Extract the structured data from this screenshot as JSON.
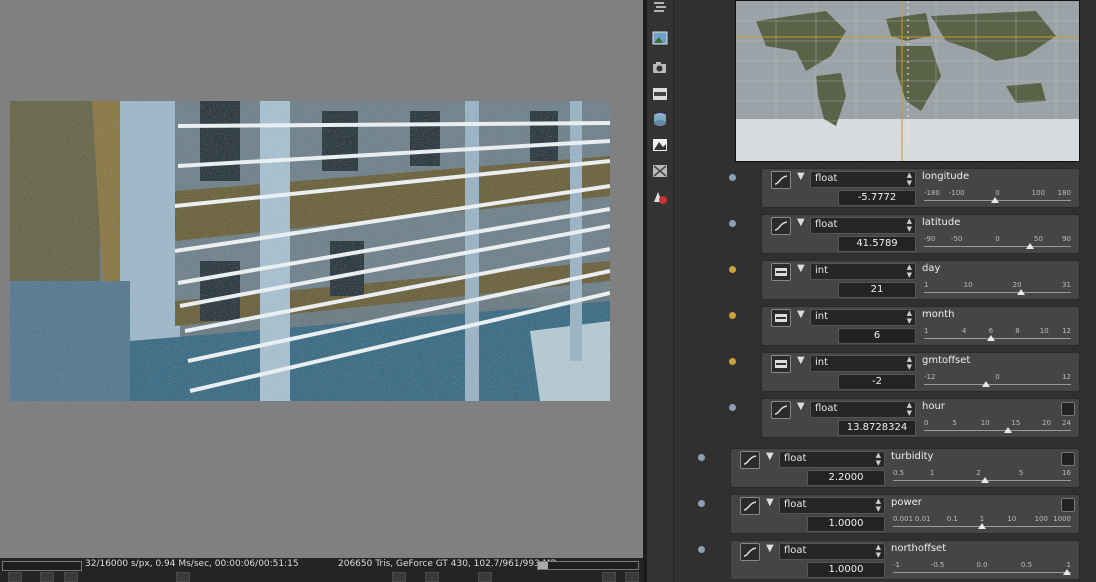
{
  "status": {
    "samples": "32/16000 s/px, 0.94 Ms/sec, 00:00:06/00:51:15",
    "gpu": "206650 Tris, GeForce GT 430, 102.7/961/993 MB"
  },
  "params": [
    {
      "id": "longitude",
      "type": "float",
      "value": "-5.7772",
      "ticks": [
        "-180",
        "-100",
        "0",
        "100",
        "180"
      ],
      "min": -180,
      "max": 180,
      "current": -5.7772,
      "kind": "float",
      "corner": false
    },
    {
      "id": "latitude",
      "type": "float",
      "value": "41.5789",
      "ticks": [
        "-90",
        "-50",
        "0",
        "50",
        "90"
      ],
      "min": -90,
      "max": 90,
      "current": 41.5789,
      "kind": "float",
      "corner": false
    },
    {
      "id": "day",
      "type": "int",
      "value": "21",
      "ticks": [
        "1",
        "10",
        "20",
        "31"
      ],
      "min": 1,
      "max": 31,
      "current": 21,
      "kind": "int",
      "corner": false
    },
    {
      "id": "month",
      "type": "int",
      "value": "6",
      "ticks": [
        "1",
        "4",
        "6",
        "8",
        "10",
        "12"
      ],
      "min": 1,
      "max": 12,
      "current": 6,
      "kind": "int",
      "corner": false
    },
    {
      "id": "gmtoffset",
      "type": "int",
      "value": "-2",
      "ticks": [
        "-12",
        "0",
        "12"
      ],
      "min": -12,
      "max": 12,
      "current": -2,
      "kind": "int",
      "corner": false
    },
    {
      "id": "hour",
      "type": "float",
      "value": "13.8728324",
      "ticks": [
        "0",
        "5",
        "10",
        "15",
        "20",
        "24"
      ],
      "min": 0,
      "max": 24,
      "current": 13.8728324,
      "kind": "float",
      "corner": true
    },
    {
      "id": "turbidity",
      "type": "float",
      "value": "2.2000",
      "ticks": [
        "0.5",
        "1",
        "2",
        "5",
        "16"
      ],
      "tickFrac": [
        0,
        0.22,
        0.48,
        0.72,
        1
      ],
      "currentFrac": 0.52,
      "kind": "float",
      "corner": true
    },
    {
      "id": "power",
      "type": "float",
      "value": "1.0000",
      "ticks": [
        "0.001",
        "0.01",
        "0.1",
        "1",
        "10",
        "100",
        "1000"
      ],
      "tickFrac": [
        0,
        0.167,
        0.333,
        0.5,
        0.667,
        0.833,
        1
      ],
      "currentFrac": 0.5,
      "kind": "float",
      "corner": true
    },
    {
      "id": "northoffset",
      "type": "float",
      "value": "1.0000",
      "ticks": [
        "-1",
        "-0.5",
        "0.0",
        "0.5",
        "1"
      ],
      "min": -1,
      "max": 1,
      "current": 1,
      "kind": "float",
      "corner": false
    }
  ],
  "tools": [
    "layers-icon",
    "image-icon",
    "camera-icon",
    "film-icon",
    "object-icon",
    "landscape-icon",
    "texture-icon",
    "material-icon"
  ]
}
